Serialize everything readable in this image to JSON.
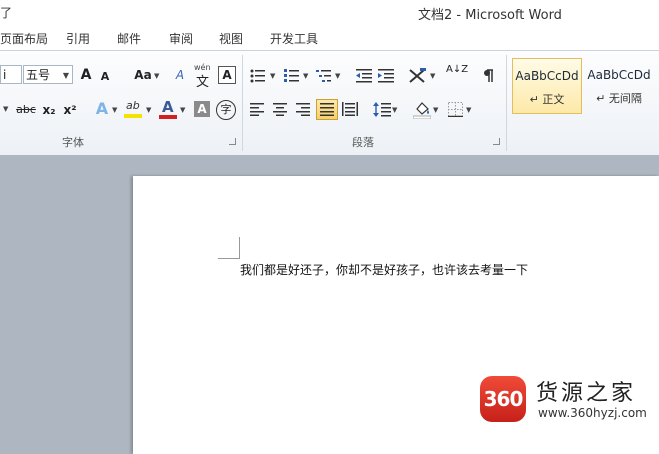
{
  "window": {
    "title": "文档2 - Microsoft Word",
    "title_left_fragment": "了"
  },
  "tabs": [
    "页面布局",
    "引用",
    "邮件",
    "审阅",
    "视图",
    "开发工具"
  ],
  "font": {
    "font_name_fragment": "i",
    "font_size": "五号",
    "grow": "A",
    "shrink": "A",
    "change_case": "Aa",
    "clear_format": "A",
    "phonetic_top": "wén",
    "phonetic": "文",
    "char_border": "A",
    "strike": "abc",
    "subscript": "x₂",
    "superscript": "x²",
    "text_effect": "A",
    "highlight": "ab",
    "font_color": "A",
    "char_shading": "A",
    "enclose": "字",
    "group_label": "字体"
  },
  "paragraph": {
    "sort": "A↓Z",
    "group_label": "段落"
  },
  "styles": [
    {
      "sample": "AaBbCcDd",
      "name": "↵ 正文"
    },
    {
      "sample": "AaBbCcDd",
      "name": "↵ 无间隔"
    }
  ],
  "document": {
    "text": "我们都是好还子，你却不是好孩子，也许该去考量一下"
  },
  "watermark": {
    "badge": "360",
    "title": "货源之家",
    "url": "www.360hyzj.com"
  },
  "colors": {
    "highlight": "#f5e200",
    "font_color": "#d21f1f",
    "active_style_border": "#e3be5f",
    "workspace": "#aeb6c1",
    "watermark_badge": "#e23427"
  }
}
